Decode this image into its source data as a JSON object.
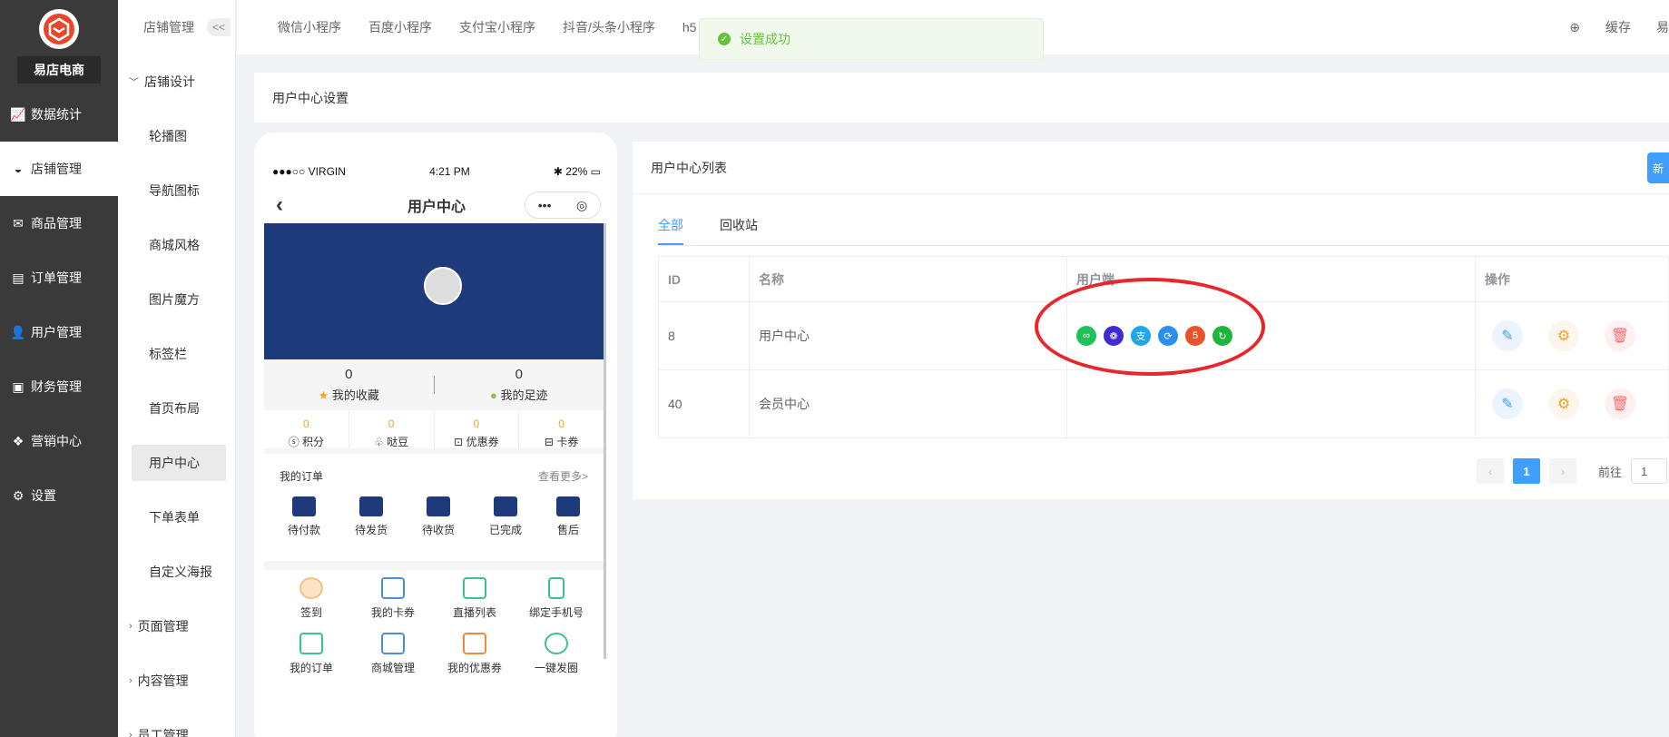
{
  "brand": {
    "name": "易店电商"
  },
  "sidebar": {
    "items": [
      {
        "label": "数据统计",
        "icon": "chart-icon"
      },
      {
        "label": "店铺管理",
        "icon": "store-icon",
        "active": true
      },
      {
        "label": "商品管理",
        "icon": "goods-icon"
      },
      {
        "label": "订单管理",
        "icon": "order-icon"
      },
      {
        "label": "用户管理",
        "icon": "user-icon"
      },
      {
        "label": "财务管理",
        "icon": "finance-icon"
      },
      {
        "label": "营销中心",
        "icon": "marketing-icon"
      },
      {
        "label": "设置",
        "icon": "gear-icon"
      }
    ]
  },
  "subnav": {
    "header": "店铺管理",
    "collapse": "<<",
    "group1": "店铺设计",
    "items": [
      "轮播图",
      "导航图标",
      "商城风格",
      "图片魔方",
      "标签栏",
      "首页布局",
      "用户中心",
      "下单表单",
      "自定义海报"
    ],
    "group2": "页面管理",
    "group3": "内容管理",
    "group4": "员工管理"
  },
  "topbar": {
    "tabs": [
      "微信小程序",
      "百度小程序",
      "支付宝小程序",
      "抖音/头条小程序",
      "h5"
    ],
    "cache": "缓存",
    "user": "易"
  },
  "toast": {
    "message": "设置成功"
  },
  "page": {
    "title": "用户中心设置"
  },
  "phone": {
    "carrier": "●●●○○ VIRGIN",
    "time": "4:21 PM",
    "battery": "22%",
    "title": "用户中心",
    "fav_count": "0",
    "fav_label": "我的收藏",
    "foot_count": "0",
    "foot_label": "我的足迹",
    "points": [
      {
        "value": "0",
        "label": "积分"
      },
      {
        "value": "0",
        "label": "哒豆"
      },
      {
        "value": "0",
        "label": "优惠券"
      },
      {
        "value": "0",
        "label": "卡券"
      }
    ],
    "orders_title": "我的订单",
    "orders_more": "查看更多>",
    "orders": [
      "待付款",
      "待发货",
      "待收货",
      "已完成",
      "售后"
    ],
    "tools_row1": [
      "签到",
      "我的卡券",
      "直播列表",
      "绑定手机号"
    ],
    "tools_row2": [
      "我的订单",
      "商城管理",
      "我的优惠券",
      "一键发圈"
    ]
  },
  "list": {
    "title": "用户中心列表",
    "new_btn": "新",
    "tabs": [
      "全部",
      "回收站"
    ],
    "columns": [
      "ID",
      "名称",
      "用户端",
      "操作"
    ],
    "rows": [
      {
        "id": "8",
        "name": "用户中心"
      },
      {
        "id": "40",
        "name": "会员中心"
      }
    ],
    "client_colors": [
      "#21c15a",
      "#3f2bd1",
      "#1ea6e8",
      "#2b8ef0",
      "#e8542a",
      "#21b43c"
    ],
    "pager": {
      "page": "1",
      "goto": "前往",
      "goto_value": "1"
    }
  }
}
